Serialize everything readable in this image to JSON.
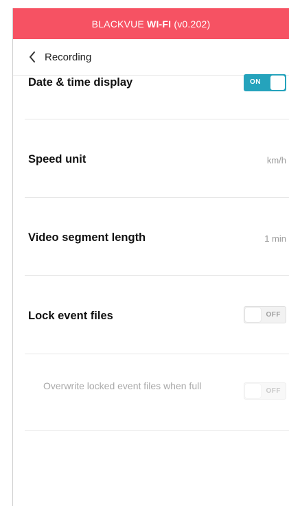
{
  "colors": {
    "header_bg": "#f65263",
    "toggle_on": "#25a3bc"
  },
  "header": {
    "prefix": "BLACKVUE",
    "bold": "WI-FI",
    "version": "(v0.202)"
  },
  "nav": {
    "back_icon": "chevron-left-icon",
    "title": "Recording"
  },
  "settings": {
    "date_time": {
      "label": "Date & time display",
      "toggle": "ON",
      "enabled": true
    },
    "speed_unit": {
      "label": "Speed unit",
      "value": "km/h"
    },
    "video_segment": {
      "label": "Video segment length",
      "value": "1 min"
    },
    "lock_event": {
      "label": "Lock event files",
      "toggle": "OFF",
      "enabled": false
    },
    "overwrite_locked": {
      "label": "Overwrite locked event files when full",
      "toggle": "OFF",
      "enabled": false,
      "disabled": true
    }
  }
}
